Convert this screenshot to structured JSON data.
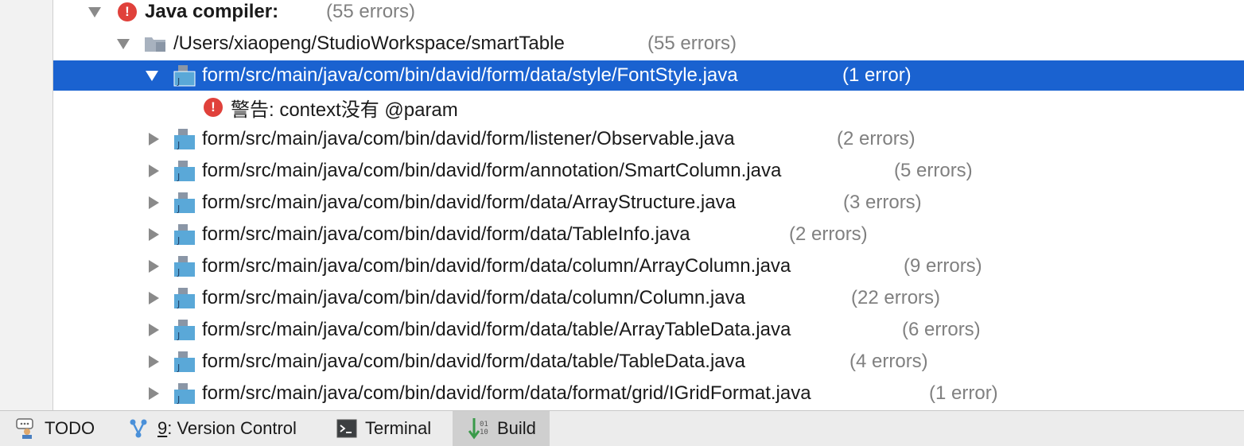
{
  "tree": {
    "root": {
      "label": "Java compiler:",
      "count": "(55 errors)"
    },
    "project": {
      "path": "/Users/xiaopeng/StudioWorkspace/smartTable",
      "count": "(55 errors)"
    },
    "files": [
      {
        "path": "form/src/main/java/com/bin/david/form/data/style/FontStyle.java",
        "count": "(1 error)",
        "expanded": true,
        "selected": true
      },
      {
        "path": "form/src/main/java/com/bin/david/form/listener/Observable.java",
        "count": "(2 errors)"
      },
      {
        "path": "form/src/main/java/com/bin/david/form/annotation/SmartColumn.java",
        "count": "(5 errors)"
      },
      {
        "path": "form/src/main/java/com/bin/david/form/data/ArrayStructure.java",
        "count": "(3 errors)"
      },
      {
        "path": "form/src/main/java/com/bin/david/form/data/TableInfo.java",
        "count": "(2 errors)"
      },
      {
        "path": "form/src/main/java/com/bin/david/form/data/column/ArrayColumn.java",
        "count": "(9 errors)"
      },
      {
        "path": "form/src/main/java/com/bin/david/form/data/column/Column.java",
        "count": "(22 errors)"
      },
      {
        "path": "form/src/main/java/com/bin/david/form/data/table/ArrayTableData.java",
        "count": "(6 errors)"
      },
      {
        "path": "form/src/main/java/com/bin/david/form/data/table/TableData.java",
        "count": "(4 errors)"
      },
      {
        "path": "form/src/main/java/com/bin/david/form/data/format/grid/IGridFormat.java",
        "count": "(1 error)"
      }
    ],
    "message": "警告: context没有 @param"
  },
  "toolbar": {
    "todo": "TODO",
    "vc_key": "9",
    "vc_label": ": Version Control",
    "terminal": "Terminal",
    "build": "Build"
  },
  "colors": {
    "selection": "#1a62d0",
    "error": "#e0413b",
    "count": "#808080"
  },
  "icons": [
    "chevron-down-icon",
    "chevron-right-icon",
    "error-icon",
    "folder-icon",
    "java-file-icon",
    "todo-icon",
    "version-control-icon",
    "terminal-icon",
    "build-icon"
  ]
}
